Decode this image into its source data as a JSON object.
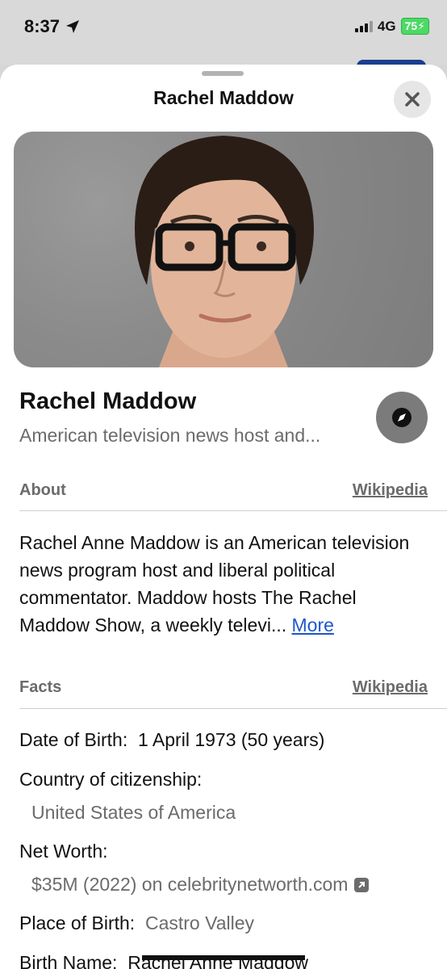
{
  "status": {
    "time": "8:37",
    "network": "4G",
    "battery": "75"
  },
  "sheet": {
    "title": "Rachel Maddow",
    "close_label": "×"
  },
  "entity": {
    "name": "Rachel Maddow",
    "subtitle": "American television news host and..."
  },
  "about": {
    "label": "About",
    "source": "Wikipedia",
    "text": "Rachel Anne Maddow is an American television news program host and liberal political commentator. Maddow hosts The Rachel Maddow Show, a weekly televi...",
    "more": "More"
  },
  "facts": {
    "label": "Facts",
    "source": "Wikipedia",
    "date_of_birth_label": "Date of Birth:",
    "date_of_birth_value": "1 April 1973 (50 years)",
    "citizenship_label": "Country of citizenship:",
    "citizenship_value": "United States of America",
    "net_worth_label": "Net Worth:",
    "net_worth_value": "$35M (2022) on celebritynetworth.com",
    "place_of_birth_label": "Place of Birth:",
    "place_of_birth_value": "Castro Valley",
    "birth_name_label": "Birth Name:",
    "birth_name_value": "Rachel Anne Maddow"
  },
  "icons": {
    "location": "location-arrow-icon",
    "close": "close-icon",
    "compass": "compass-icon",
    "external": "external-link-icon"
  }
}
